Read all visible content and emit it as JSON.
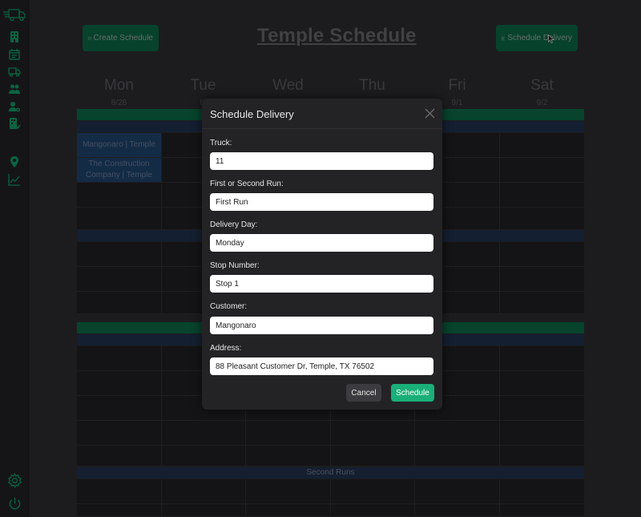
{
  "header": {
    "title": "Temple Schedule",
    "create_schedule_label": "Create Schedule",
    "schedule_delivery_label": "Schedule Delivery"
  },
  "sidebar": {
    "icons": [
      "truck-logo-icon",
      "building-icon",
      "calendar-icon",
      "delivery-truck-icon",
      "people-icon",
      "person-settings-icon",
      "building-check-icon",
      "location-pin-icon",
      "graph-icon",
      "settings-icon",
      "power-icon"
    ]
  },
  "days": [
    {
      "name": "Mon",
      "date": "8/28"
    },
    {
      "name": "Tue",
      "date": "8/"
    },
    {
      "name": "Wed",
      "date": ""
    },
    {
      "name": "Thu",
      "date": ""
    },
    {
      "name": "Fri",
      "date": "9/1"
    },
    {
      "name": "Sat",
      "date": "9/2"
    }
  ],
  "calendar": {
    "events": [
      "Mangonaro | Temple",
      "The Construction Company | Temple"
    ],
    "second_runs_label": "Second Runs"
  },
  "modal": {
    "title": "Schedule Delivery",
    "fields": [
      {
        "label": "Truck:",
        "value": "11"
      },
      {
        "label": "First or Second Run:",
        "value": "First Run"
      },
      {
        "label": "Delivery Day:",
        "value": "Monday"
      },
      {
        "label": "Stop Number:",
        "value": "Stop 1"
      },
      {
        "label": "Customer:",
        "value": "Mangonaro"
      },
      {
        "label": "Address:",
        "value": "88 Pleasant Customer Dr, Temple, TX 76502"
      }
    ],
    "cancel_label": "Cancel",
    "schedule_label": "Schedule"
  },
  "colors": {
    "accent_green": "#1aaf78",
    "brand_green": "#0a5c3d",
    "run_blue": "#1c2b44",
    "event_blue": "#1d3c61"
  }
}
